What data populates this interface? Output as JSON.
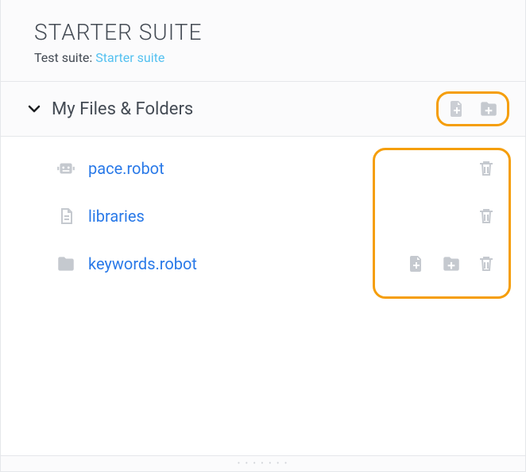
{
  "header": {
    "title": "STARTER SUITE",
    "sub_label": "Test suite: ",
    "sub_link": "Starter suite"
  },
  "section": {
    "title": "My Files & Folders"
  },
  "files": [
    {
      "name": "pace.robot",
      "icon": "robot",
      "actions": [
        "trash"
      ]
    },
    {
      "name": "libraries",
      "icon": "file",
      "actions": [
        "trash"
      ]
    },
    {
      "name": "keywords.robot",
      "icon": "folder",
      "actions": [
        "add-file",
        "add-folder",
        "trash"
      ]
    }
  ]
}
